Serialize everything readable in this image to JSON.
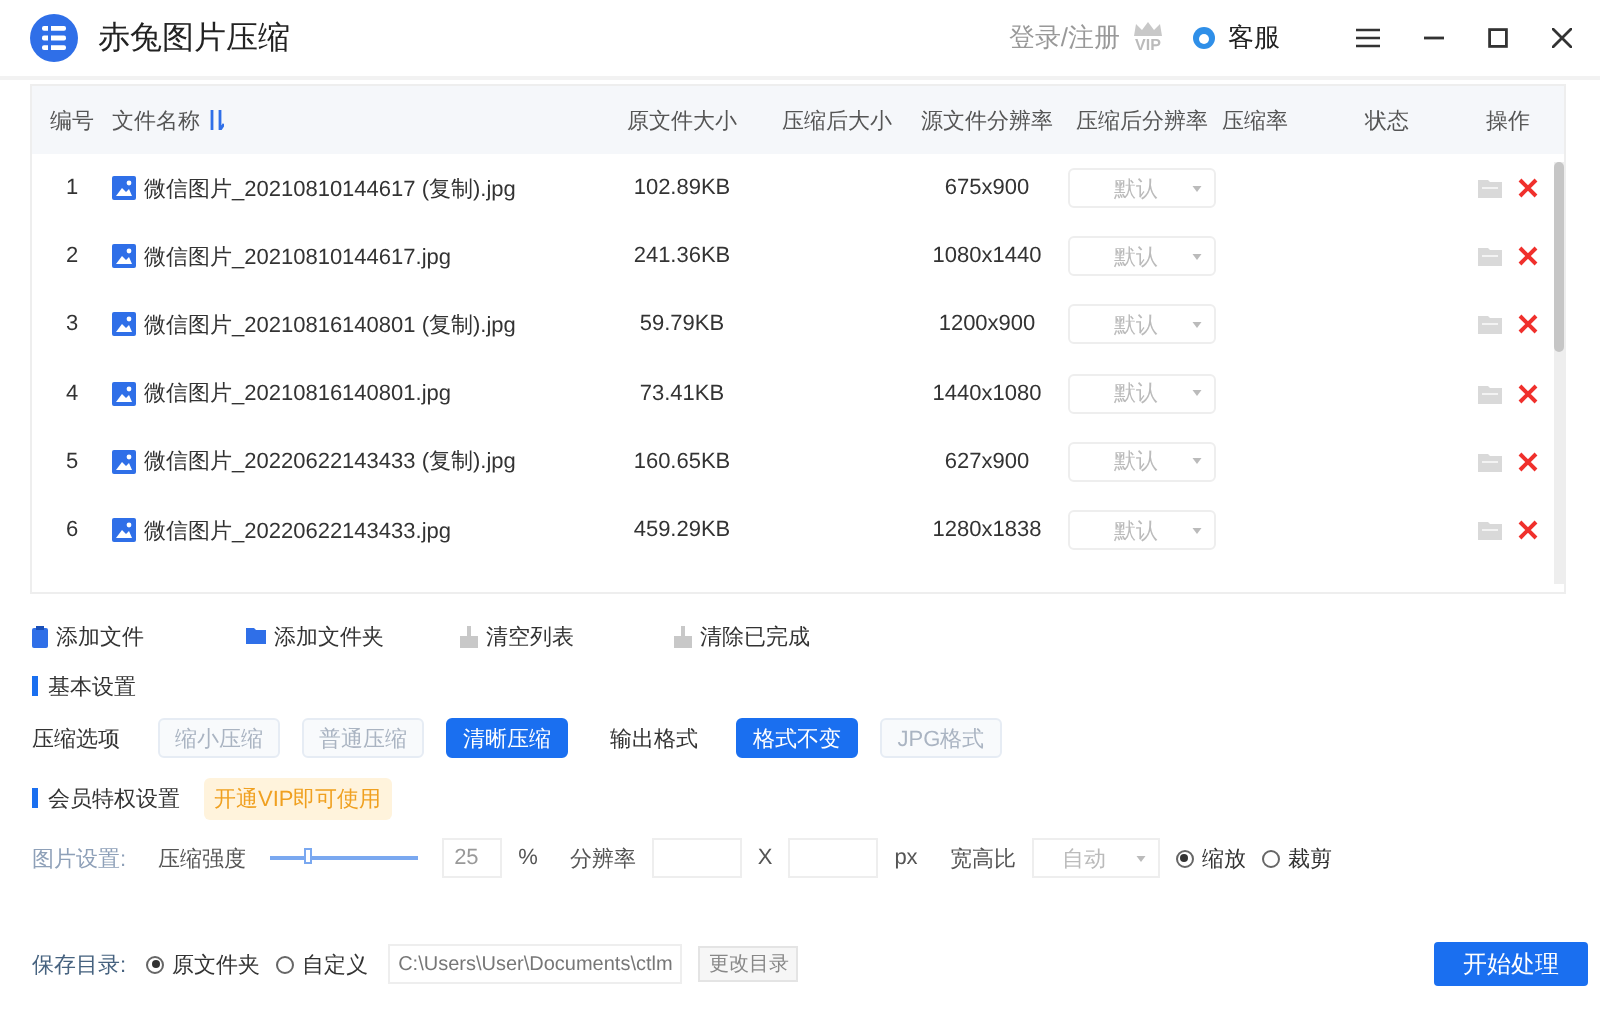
{
  "window": {
    "title": "赤兔图片压缩",
    "login": "登录/注册",
    "vip": "VIP",
    "service": "客服"
  },
  "table": {
    "columns": [
      "编号",
      "文件名称",
      "原文件大小",
      "压缩后大小",
      "源文件分辨率",
      "压缩后分辨率",
      "压缩率",
      "状态",
      "操作"
    ],
    "rows": [
      {
        "number": "1",
        "name": "微信图片_20210810144617 (复制).jpg",
        "size": "102.89KB",
        "resolution": "675x900",
        "target_resolution": "默认"
      },
      {
        "number": "2",
        "name": "微信图片_20210810144617.jpg",
        "size": "241.36KB",
        "resolution": "1080x1440",
        "target_resolution": "默认"
      },
      {
        "number": "3",
        "name": "微信图片_20210816140801 (复制).jpg",
        "size": "59.79KB",
        "resolution": "1200x900",
        "target_resolution": "默认"
      },
      {
        "number": "4",
        "name": "微信图片_20210816140801.jpg",
        "size": "73.41KB",
        "resolution": "1440x1080",
        "target_resolution": "默认"
      },
      {
        "number": "5",
        "name": "微信图片_20220622143433 (复制).jpg",
        "size": "160.65KB",
        "resolution": "627x900",
        "target_resolution": "默认"
      },
      {
        "number": "6",
        "name": "微信图片_20220622143433.jpg",
        "size": "459.29KB",
        "resolution": "1280x1838",
        "target_resolution": "默认"
      }
    ]
  },
  "toolbar": [
    {
      "label": "添加文件",
      "kind": "file"
    },
    {
      "label": "添加文件夹",
      "kind": "folder"
    },
    {
      "label": "清空列表",
      "kind": "clear"
    },
    {
      "label": "清除已完成",
      "kind": "clear"
    }
  ],
  "basic": {
    "title": "基本设置",
    "compress_label": "压缩选项",
    "compress_options": [
      {
        "label": "缩小压缩",
        "selected": false
      },
      {
        "label": "普通压缩",
        "selected": false
      },
      {
        "label": "清晰压缩",
        "selected": true
      }
    ],
    "format_label": "输出格式",
    "format_options": [
      {
        "label": "格式不变",
        "selected": true
      },
      {
        "label": "JPG格式",
        "selected": false
      }
    ]
  },
  "vip": {
    "title": "会员特权设置",
    "hint": "开通VIP即可使用"
  },
  "image": {
    "label": "图片设置:",
    "strength_label": "压缩强度",
    "level": 0.25,
    "strength_value": "25",
    "percent": "%",
    "resolution_label": "分辨率",
    "times": "X",
    "px": "px",
    "ratio_label": "宽高比",
    "ratio_value": "自动",
    "modes": [
      {
        "label": "缩放",
        "selected": true
      },
      {
        "label": "裁剪",
        "selected": false
      }
    ]
  },
  "save": {
    "label": "保存目录:",
    "options": [
      {
        "label": "原文件夹",
        "selected": true
      },
      {
        "label": "自定义",
        "selected": false
      }
    ],
    "path": "C:\\Users\\User\\Documents\\ctlm",
    "change": "更改目录"
  },
  "start": "开始处理"
}
